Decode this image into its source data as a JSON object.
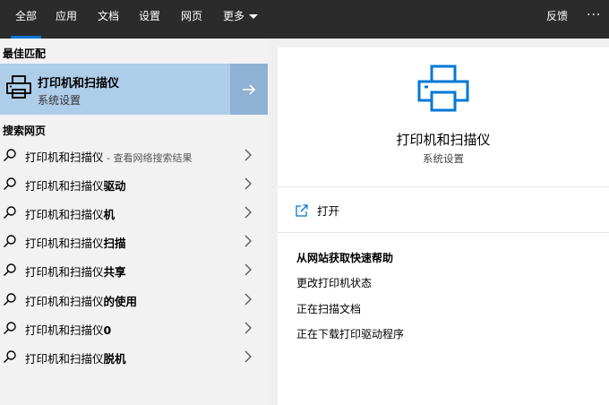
{
  "tabs": [
    {
      "label": "全部"
    },
    {
      "label": "应用"
    },
    {
      "label": "文档"
    },
    {
      "label": "设置"
    },
    {
      "label": "网页"
    },
    {
      "label": "更多"
    }
  ],
  "feedback": "反馈",
  "more_dots": "···",
  "best_match": {
    "header": "最佳匹配",
    "title": "打印机和扫描仪",
    "subtitle": "系统设置"
  },
  "web_search": {
    "header": "搜索网页",
    "items": [
      {
        "prefix": "打印机和扫描仪",
        "bold": "",
        "hint": " - 查看网络搜索结果"
      },
      {
        "prefix": "打印机和扫描仪",
        "bold": "驱动",
        "hint": ""
      },
      {
        "prefix": "打印机和扫描仪",
        "bold": "机",
        "hint": ""
      },
      {
        "prefix": "打印机和扫描仪",
        "bold": "扫描",
        "hint": ""
      },
      {
        "prefix": "打印机和扫描仪",
        "bold": "共享",
        "hint": ""
      },
      {
        "prefix": "打印机和扫描仪",
        "bold": "的使用",
        "hint": ""
      },
      {
        "prefix": "打印机和扫描仪",
        "bold": "0",
        "hint": ""
      },
      {
        "prefix": "打印机和扫描仪",
        "bold": "脱机",
        "hint": ""
      }
    ]
  },
  "detail": {
    "title": "打印机和扫描仪",
    "subtitle": "系统设置",
    "open_label": "打开",
    "help_header": "从网站获取快速帮助",
    "help_links": [
      "更改打印机状态",
      "正在扫描文档",
      "正在下载打印驱动程序"
    ]
  },
  "colors": {
    "topbar": "#2b2b2b",
    "accent": "#0078d7",
    "best_bg": "#aecde9",
    "best_arrow_bg": "#8fb1d3"
  }
}
